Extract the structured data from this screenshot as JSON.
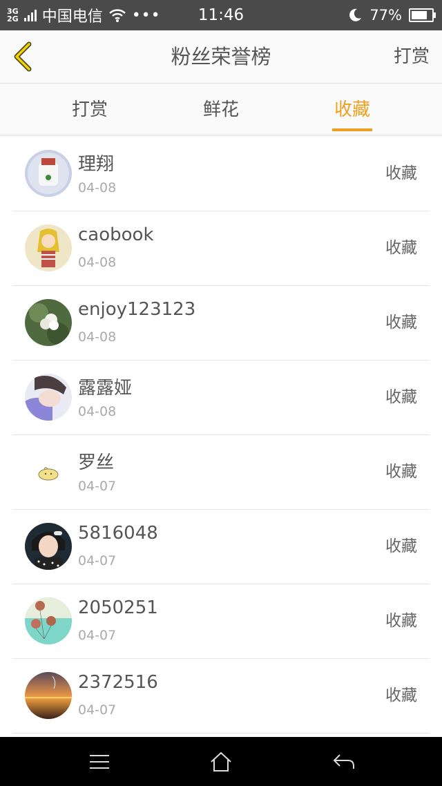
{
  "status_bar": {
    "network_type_top": "3G",
    "network_type_bottom": "2G",
    "carrier": "中国电信",
    "more": "•••",
    "time": "11:46",
    "battery_percent": "77%",
    "battery_level": 0.77
  },
  "header": {
    "title": "粉丝荣誉榜",
    "action_label": "打赏",
    "back_icon": "chevron-left-icon"
  },
  "tabs": [
    {
      "label": "打赏",
      "active": false
    },
    {
      "label": "鲜花",
      "active": false
    },
    {
      "label": "收藏",
      "active": true
    }
  ],
  "accent_color": "#f0a020",
  "list": [
    {
      "name": "理翔",
      "date": "04-08",
      "action": "收藏"
    },
    {
      "name": "caobook",
      "date": "04-08",
      "action": "收藏"
    },
    {
      "name": "enjoy123123",
      "date": "04-08",
      "action": "收藏"
    },
    {
      "name": "露露娅",
      "date": "04-08",
      "action": "收藏"
    },
    {
      "name": "罗丝",
      "date": "04-07",
      "action": "收藏"
    },
    {
      "name": "5816048",
      "date": "04-07",
      "action": "收藏"
    },
    {
      "name": "2050251",
      "date": "04-07",
      "action": "收藏"
    },
    {
      "name": "2372516",
      "date": "04-07",
      "action": "收藏"
    }
  ],
  "nav_bar": {
    "menu_icon": "menu-icon",
    "home_icon": "home-icon",
    "back_icon": "back-arrow-icon"
  }
}
